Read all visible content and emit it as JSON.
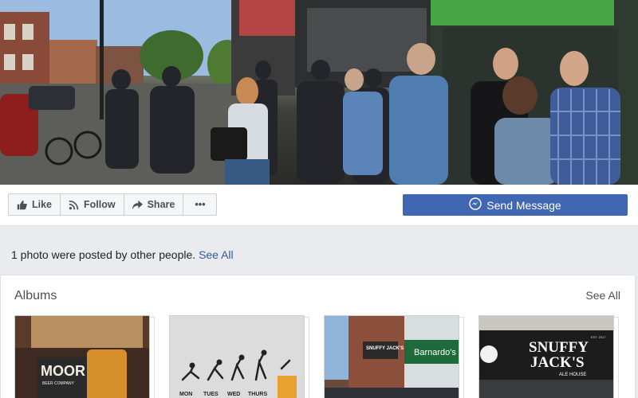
{
  "actions": {
    "like": "Like",
    "follow": "Follow",
    "share": "Share",
    "more": "•••",
    "send_message": "Send Message"
  },
  "posted": {
    "text": "1 photo were posted by other people.",
    "link": "See All"
  },
  "albums": {
    "title": "Albums",
    "see_all": "See All",
    "items": [
      {
        "sign_text": "MOOR",
        "sign_sub": "BEER COMPANY"
      },
      {
        "days": [
          "MON",
          "TUES",
          "WED",
          "THURS"
        ]
      },
      {
        "sign_text": "SNUFFY JACK'S",
        "shop_text": "Barnardo's"
      },
      {
        "sign_line1": "SNUFFY",
        "sign_line2": "JACK'S",
        "sign_sub": "ALE HOUSE",
        "est": "EST. 2017"
      }
    ]
  },
  "colors": {
    "brand_blue": "#4267b2",
    "link_blue": "#365899",
    "page_bg": "#e9ebee"
  }
}
